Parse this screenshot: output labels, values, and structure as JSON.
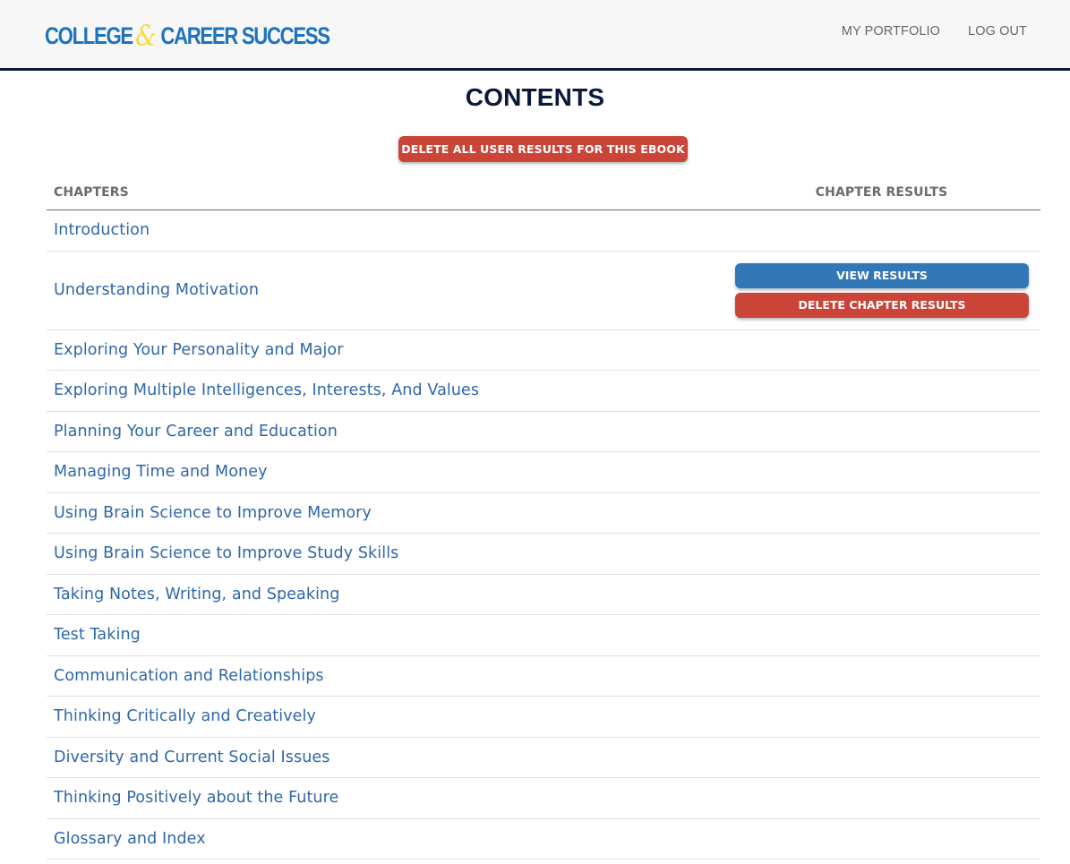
{
  "header": {
    "logo": {
      "part1": "COLLEGE",
      "amp": "&",
      "part2": "CAREER SUCCESS"
    },
    "nav": [
      {
        "label": "MY PORTFOLIO"
      },
      {
        "label": "LOG OUT"
      }
    ]
  },
  "main": {
    "title": "CONTENTS",
    "delete_all_label": "DELETE ALL USER RESULTS FOR THIS EBOOK",
    "table": {
      "headers": {
        "chapters": "CHAPTERS",
        "results": "CHAPTER RESULTS"
      },
      "rows": [
        {
          "chapter": "Introduction"
        },
        {
          "chapter": "Understanding Motivation",
          "view_label": "VIEW RESULTS",
          "delete_label": "DELETE CHAPTER RESULTS"
        },
        {
          "chapter": "Exploring Your Personality and Major"
        },
        {
          "chapter": "Exploring Multiple Intelligences, Interests, And Values"
        },
        {
          "chapter": "Planning Your Career and Education"
        },
        {
          "chapter": "Managing Time and Money"
        },
        {
          "chapter": "Using Brain Science to Improve Memory"
        },
        {
          "chapter": "Using Brain Science to Improve Study Skills"
        },
        {
          "chapter": "Taking Notes, Writing, and Speaking"
        },
        {
          "chapter": "Test Taking"
        },
        {
          "chapter": "Communication and Relationships"
        },
        {
          "chapter": "Thinking Critically and Creatively"
        },
        {
          "chapter": "Diversity and Current Social Issues"
        },
        {
          "chapter": "Thinking Positively about the Future"
        },
        {
          "chapter": "Glossary and Index"
        }
      ]
    }
  },
  "colors": {
    "brand_blue": "#1e73be",
    "brand_yellow": "#f7dc3c",
    "navy": "#0b1a3a",
    "link_blue": "#2f67a7",
    "danger_red": "#cb4438",
    "primary_blue": "#3278b8"
  }
}
